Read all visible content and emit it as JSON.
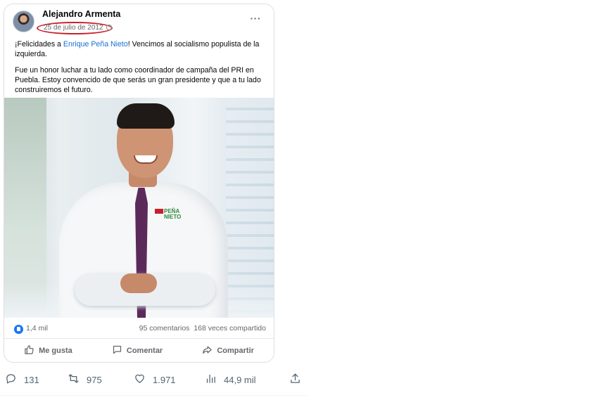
{
  "fb_post": {
    "author": "Alejandro Armenta",
    "date": "25 de julio de 2012",
    "more_label": "···",
    "text_intro": "¡Felicidades a ",
    "mention": "Enrique Peña Nieto",
    "text_after_mention": "! Vencimos al socialismo populista de la izquierda.",
    "paragraph2": "Fue un honor luchar a tu lado como coordinador de campaña del PRI en Puebla. Estoy convencido de que serás un gran presidente y que a tu lado construiremos el futuro.",
    "shirt_logo_line1": "PEÑA",
    "shirt_logo_line2": "NIETO",
    "reactions": "1,4 mil",
    "comments": "95 comentarios",
    "shares": "168 veces compartido",
    "actions": {
      "like": "Me gusta",
      "comment": "Comentar",
      "share": "Compartir"
    }
  },
  "tweet_actions": {
    "replies": "131",
    "retweets": "975",
    "likes": "1.971",
    "views": "44,9 mil"
  },
  "icons": {
    "reply": "reply-icon",
    "retweet": "retweet-icon",
    "like": "heart-icon",
    "views": "views-icon",
    "share": "share-icon"
  },
  "colors": {
    "mention": "#1a6fd6",
    "highlight_circle": "#c8202a",
    "fb_like_blue": "#1877f2",
    "tweet_gray": "#536471"
  }
}
